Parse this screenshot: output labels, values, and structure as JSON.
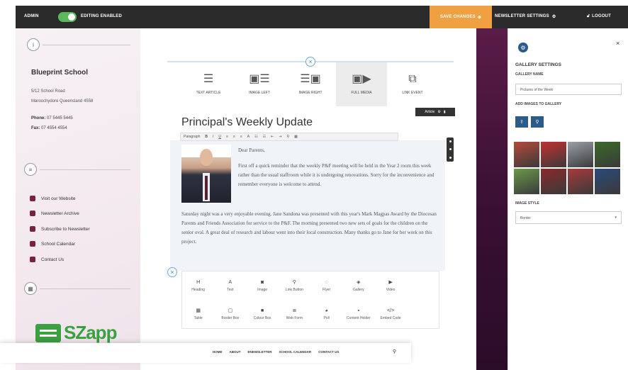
{
  "topbar": {
    "admin_label": "ADMIN",
    "editing_label": "EDITING ENABLED",
    "save_label": "SAVE CHANGES",
    "newsletter_settings_label": "NEWSLETTER SETTINGS",
    "logout_label": "LOGOUT"
  },
  "sidebar": {
    "school_name": "Blueprint School",
    "address_line1": "5/12 School Road",
    "address_line2": "Maroochydore Queensland 4558",
    "phone_label": "Phone:",
    "phone_value": "07 5445 5445",
    "fax_label": "Fax:",
    "fax_value": "07 4554 4554",
    "links": [
      {
        "label": "Visit our Website",
        "icon": "globe-icon"
      },
      {
        "label": "Newsletter Archive",
        "icon": "document-icon"
      },
      {
        "label": "Subscribe to Newsletter",
        "icon": "envelope-icon"
      },
      {
        "label": "School Calendar",
        "icon": "calendar-icon"
      },
      {
        "label": "Contact Us",
        "icon": "chat-icon"
      }
    ],
    "logo_text": "SZapp"
  },
  "editor": {
    "layouts": [
      {
        "label": "TEXT ARTICLE",
        "glyph": "☰"
      },
      {
        "label": "IMAGE LEFT",
        "glyph": "▣☰"
      },
      {
        "label": "IMAGE RIGHT",
        "glyph": "☰▣"
      },
      {
        "label": "FULL MEDIA",
        "glyph": "▣▶"
      },
      {
        "label": "LINK EVENT",
        "glyph": "⧉"
      }
    ],
    "article_badge": "Article",
    "title": "Principal's Weekly Update",
    "toolbar_format": "Paragraph",
    "salutation": "Dear Parents,",
    "para1": "First off a quick reminder that the weekly P&F meeting will be held in the Year 2 room this week rather than the usual staffroom while it is undergoing renovations. Sorry for the inconvenience and remember everyone is welcome to attend.",
    "para2": "Saturday night was a very enjoyable evening. Jane Sandona was presented with this year's Mark Magpas Award by the Diocesan Parents and Friends Association for service to the P&F. The morning presented two new sets of goals for the children on the senior oval. A great deal of research and labour went into their local construction. Many thanks go to Jane for her work on this project.",
    "widgets": [
      {
        "label": "Heading",
        "glyph": "H"
      },
      {
        "label": "Text",
        "glyph": "A"
      },
      {
        "label": "Image",
        "glyph": "◙"
      },
      {
        "label": "Link Button",
        "glyph": "⚲"
      },
      {
        "label": "Flyer",
        "glyph": "◌"
      },
      {
        "label": "Gallery",
        "glyph": "◈"
      },
      {
        "label": "Video",
        "glyph": "▶"
      },
      {
        "label": "",
        "glyph": ""
      },
      {
        "label": "Table",
        "glyph": "▦"
      },
      {
        "label": "Border Box",
        "glyph": "▢"
      },
      {
        "label": "Colour Box",
        "glyph": "■"
      },
      {
        "label": "Web Form",
        "glyph": "≣"
      },
      {
        "label": "Poll",
        "glyph": "◕"
      },
      {
        "label": "Content Holder",
        "glyph": "▪"
      },
      {
        "label": "Embed Code",
        "glyph": "</>"
      },
      {
        "label": "",
        "glyph": ""
      }
    ]
  },
  "settings": {
    "title": "GALLERY SETTINGS",
    "gallery_name_label": "GALLERY NAME",
    "gallery_name_value": "Pictures of the Week",
    "add_images_label": "ADD IMAGES TO GALLERY",
    "image_style_label": "IMAGE STYLE",
    "image_style_value": "Border",
    "thumb_colors": [
      "#b44a3a",
      "#c43030",
      "#9aa0a8",
      "#3a6a2a",
      "#6a9a4a",
      "#8a2a2a",
      "#a83a3a",
      "#2a4a7a"
    ]
  },
  "site_nav": {
    "items": [
      "HOME",
      "ABOUT",
      "ENEWSLETTER",
      "SCHOOL CALENDAR",
      "CONTACT US"
    ]
  }
}
